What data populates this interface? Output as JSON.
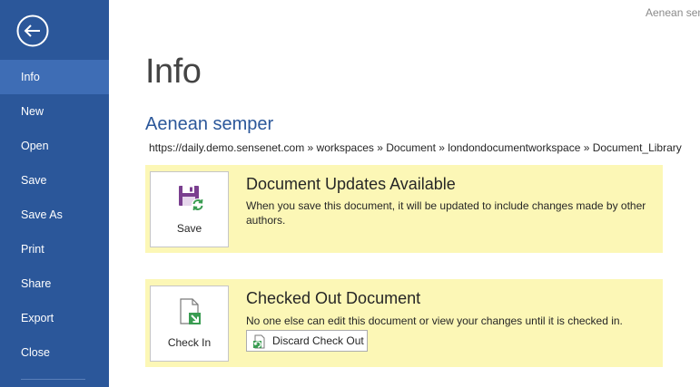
{
  "sidebar": {
    "back_icon": "back-arrow-icon",
    "items": [
      {
        "label": "Info",
        "active": true
      },
      {
        "label": "New"
      },
      {
        "label": "Open"
      },
      {
        "label": "Save"
      },
      {
        "label": "Save As"
      },
      {
        "label": "Print"
      },
      {
        "label": "Share"
      },
      {
        "label": "Export"
      },
      {
        "label": "Close"
      }
    ]
  },
  "header": {
    "user_name": "Aenean semper"
  },
  "main": {
    "title": "Info",
    "document_title": "Aenean semper",
    "document_path": "https://daily.demo.sensenet.com » workspaces » Document » londondocumentworkspace » Document_Library",
    "updates_panel": {
      "tile_label": "Save",
      "tile_icon": "save-sync-icon",
      "heading": "Document Updates Available",
      "text": "When you save this document, it will be updated to include changes made by other authors."
    },
    "checkout_panel": {
      "tile_label": "Check In",
      "tile_icon": "check-in-icon",
      "heading": "Checked Out Document",
      "text": "No one else can edit this document or view your changes until it is checked in.",
      "discard_label": "Discard Check Out",
      "discard_icon": "discard-checkout-icon"
    }
  },
  "colors": {
    "sidebar": "#2b579a",
    "sidebar_active": "#3e6db5",
    "accent_text": "#2b579a",
    "panel_background": "#fcf7b6"
  }
}
